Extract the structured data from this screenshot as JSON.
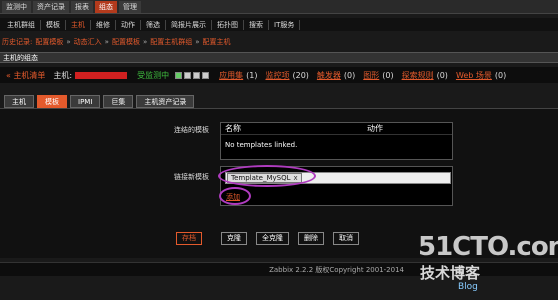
{
  "top_tabs": [
    "监测中",
    "资产记录",
    "报表",
    "组态",
    "管理"
  ],
  "top_active_index": 3,
  "sub_nav": [
    "主机群组",
    "模板",
    "主机",
    "维修",
    "动作",
    "筛选",
    "简报片展示",
    "拓扑图",
    "搜索",
    "IT服务"
  ],
  "sub_active_index": 2,
  "history": {
    "label": "历史记录:",
    "crumbs": [
      "配置模板",
      "动态汇入",
      "配置模板",
      "配置主机群组",
      "配置主机"
    ]
  },
  "section_title": "主机的组态",
  "host_bar": {
    "back": "« 主机清单",
    "host_label": "主机:",
    "monitor_status": "受监测中",
    "links": [
      {
        "label": "应用集",
        "count": "(1)"
      },
      {
        "label": "监控项",
        "count": "(20)"
      },
      {
        "label": "触发器",
        "count": "(0)"
      },
      {
        "label": "图形",
        "count": "(0)"
      },
      {
        "label": "探索规则",
        "count": "(0)"
      },
      {
        "label": "Web 场景",
        "count": "(0)"
      }
    ]
  },
  "tabs": [
    "主机",
    "模板",
    "IPMI",
    "巨集",
    "主机资产记录"
  ],
  "tab_active_index": 1,
  "form": {
    "linked_label": "连结的模板",
    "col_name": "名称",
    "col_action": "动作",
    "empty_text": "No templates linked.",
    "new_label": "链接新模板",
    "template_value": "Template_MySQL",
    "chip_remove": "x",
    "add_link": "添加"
  },
  "buttons": {
    "save": "存档",
    "clone": "克隆",
    "full_clone": "全克隆",
    "delete": "删除",
    "cancel": "取消"
  },
  "footer_text": "Zabbix 2.2.2 版权Copyright 2001-2014",
  "watermark": {
    "big": "51CTO.com",
    "mid": "技术博客",
    "sub": "Blog"
  },
  "colors": {
    "accent": "#e45a2c",
    "active_tab": "#b33a1c",
    "monitor_ok": "#3fbf3f",
    "annotation_ring": "#b03cc0"
  }
}
